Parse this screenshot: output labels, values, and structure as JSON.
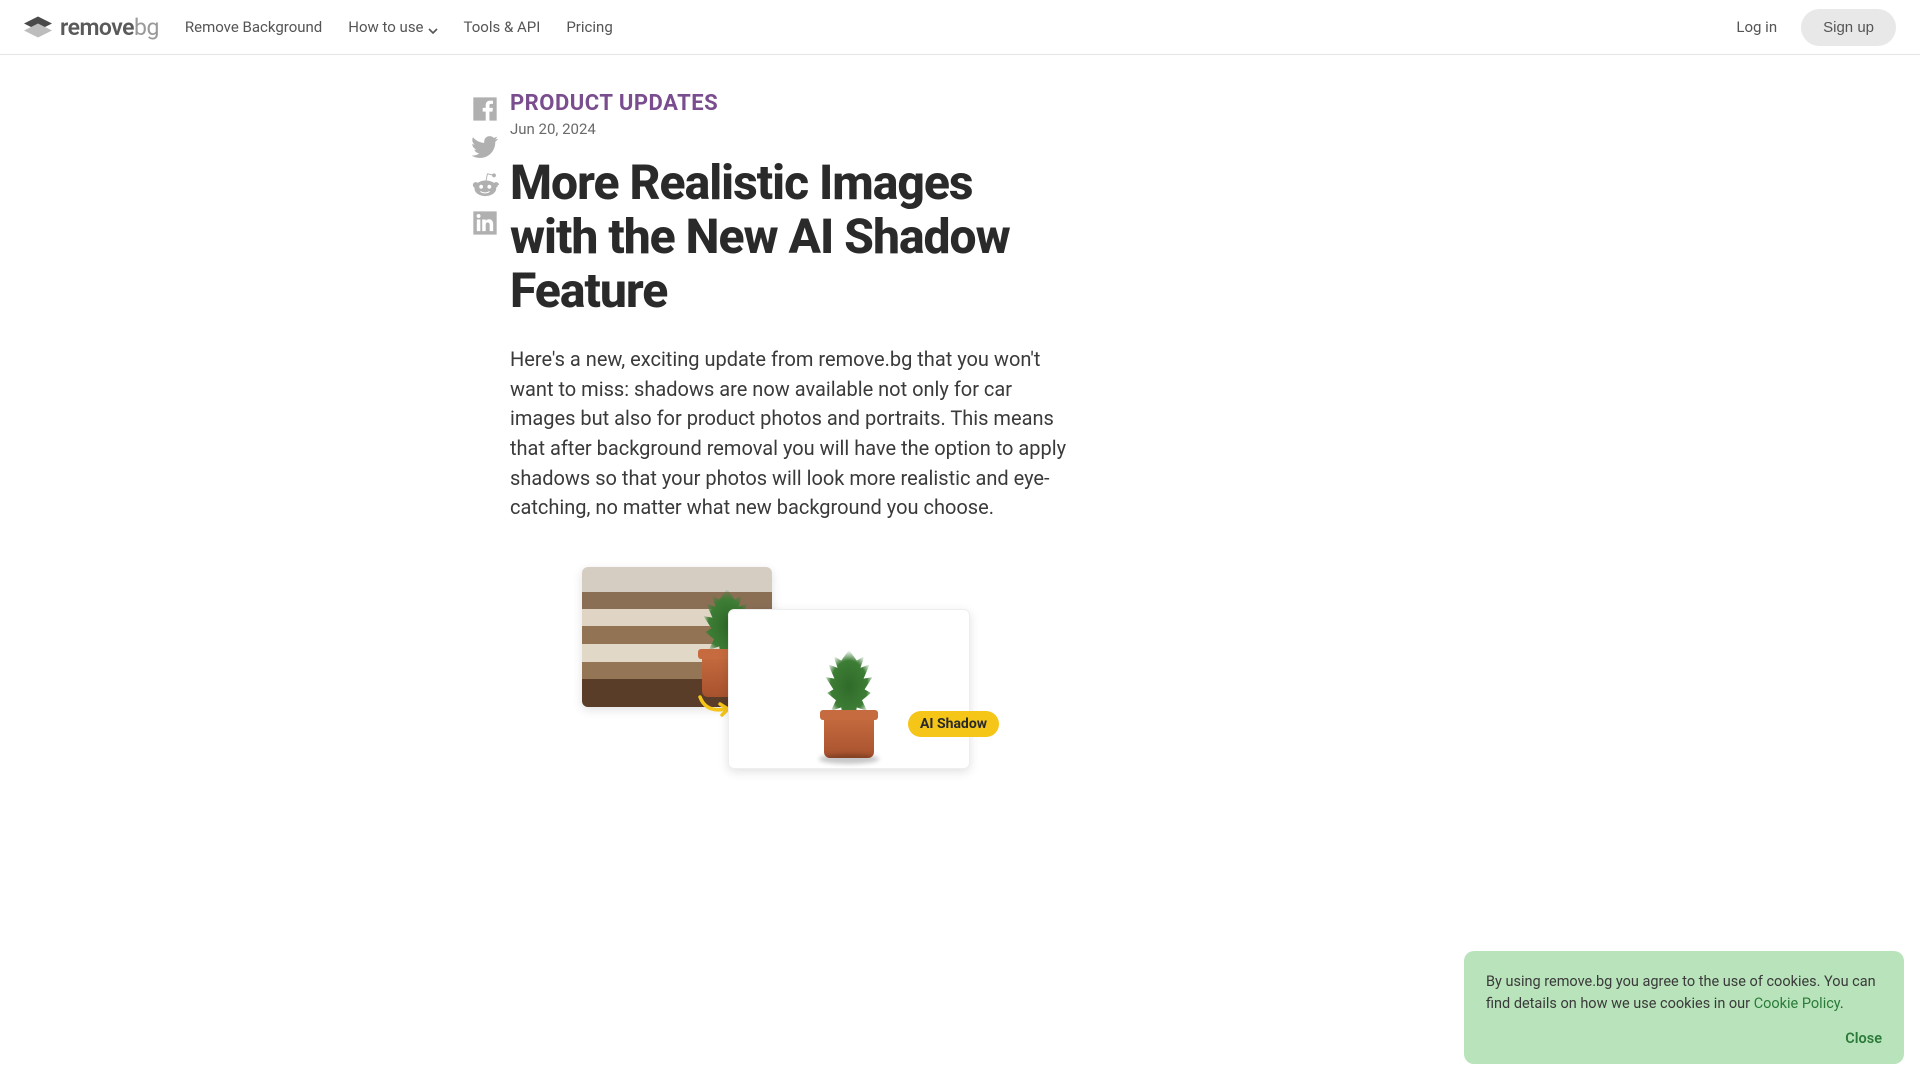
{
  "brand": {
    "name_main": "remove",
    "name_suffix": "bg"
  },
  "nav": {
    "remove_bg": "Remove Background",
    "how_to_use": "How to use",
    "tools_api": "Tools & API",
    "pricing": "Pricing"
  },
  "auth": {
    "login": "Log in",
    "signup": "Sign up"
  },
  "article": {
    "category": "PRODUCT UPDATES",
    "date": "Jun 20, 2024",
    "title": "More Realistic Images with the New AI Shadow Feature",
    "body": "Here's a new, exciting update from remove.bg that you won't want to miss: shadows are now available not only for car images but also for product photos and portraits. This means that after background removal you will have the option to apply shadows so that your photos will look more realistic and eye-catching, no matter what new background you choose.",
    "image_badge": "AI Shadow"
  },
  "cookie": {
    "text_before": "By using remove.bg you agree to the use of cookies. You can find details on how we use cookies in our ",
    "link": "Cookie Policy",
    "text_after": ".",
    "close": "Close"
  }
}
